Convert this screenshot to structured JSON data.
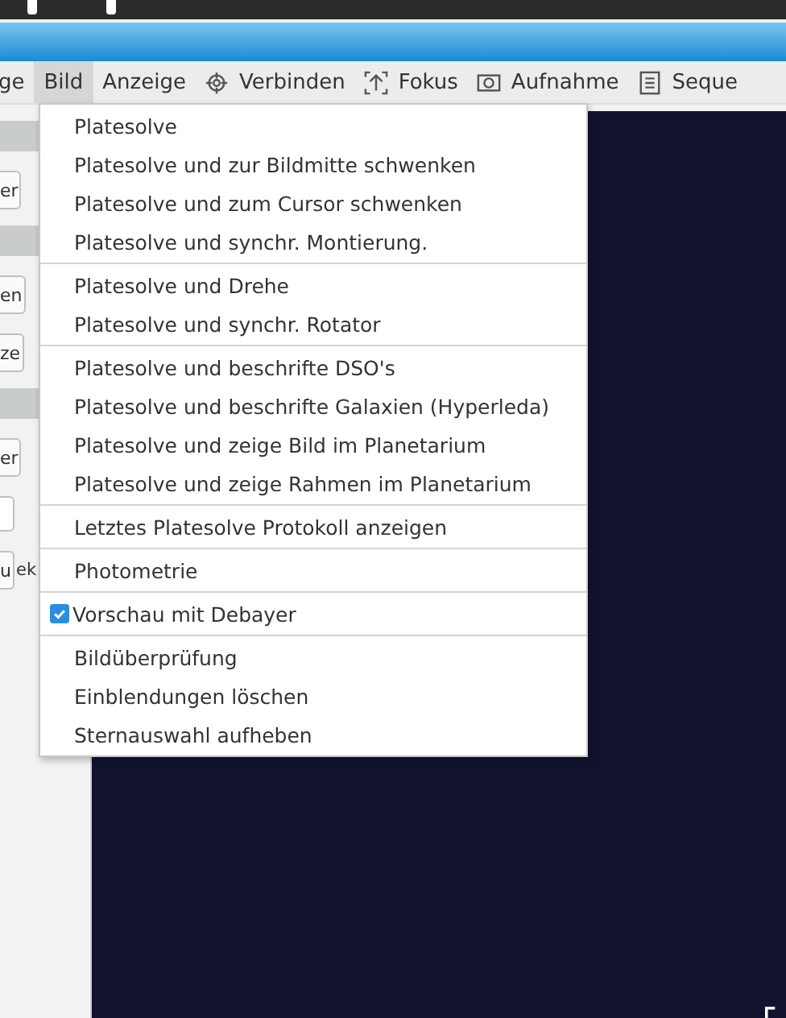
{
  "menubar": [
    {
      "label": "ge",
      "kind": "plain",
      "selected": false
    },
    {
      "label": "Bild",
      "kind": "plain",
      "selected": true
    },
    {
      "label": "Anzeige",
      "kind": "plain",
      "selected": false
    },
    {
      "label": "Verbinden",
      "kind": "target",
      "selected": false
    },
    {
      "label": "Fokus",
      "kind": "focus",
      "selected": false
    },
    {
      "label": "Aufnahme",
      "kind": "camera",
      "selected": false
    },
    {
      "label": "Seque",
      "kind": "list",
      "selected": false
    }
  ],
  "left_panel": [
    {
      "kind": "header"
    },
    {
      "kind": "button",
      "label": "er"
    },
    {
      "kind": "header"
    },
    {
      "kind": "button",
      "label": "en"
    },
    {
      "kind": "button",
      "label": "ze"
    },
    {
      "kind": "header"
    },
    {
      "kind": "button",
      "label": "er"
    },
    {
      "kind": "field"
    },
    {
      "kind": "button",
      "label": "u",
      "after": "ek"
    }
  ],
  "menu": [
    [
      {
        "kind": "action",
        "label": "Platesolve"
      },
      {
        "kind": "action",
        "label": "Platesolve und zur Bildmitte schwenken"
      },
      {
        "kind": "action",
        "label": "Platesolve und zum Cursor schwenken"
      },
      {
        "kind": "action",
        "label": "Platesolve und synchr. Montierung."
      }
    ],
    [
      {
        "kind": "action",
        "label": "Platesolve und Drehe"
      },
      {
        "kind": "action",
        "label": "Platesolve und synchr. Rotator"
      }
    ],
    [
      {
        "kind": "action",
        "label": "Platesolve und beschrifte DSO's"
      },
      {
        "kind": "action",
        "label": "Platesolve und beschrifte Galaxien (Hyperleda)"
      },
      {
        "kind": "action",
        "label": "Platesolve und zeige Bild im Planetarium"
      },
      {
        "kind": "action",
        "label": "Platesolve und zeige Rahmen im Planetarium"
      }
    ],
    [
      {
        "kind": "action",
        "label": "Letztes Platesolve Protokoll anzeigen"
      }
    ],
    [
      {
        "kind": "action",
        "label": "Photometrie"
      }
    ],
    [
      {
        "kind": "check",
        "label": "Vorschau mit Debayer",
        "checked": true
      }
    ],
    [
      {
        "kind": "action",
        "label": "Bildüberprüfung"
      },
      {
        "kind": "action",
        "label": "Einblendungen löschen"
      },
      {
        "kind": "action",
        "label": "Sternauswahl aufheben"
      }
    ]
  ]
}
